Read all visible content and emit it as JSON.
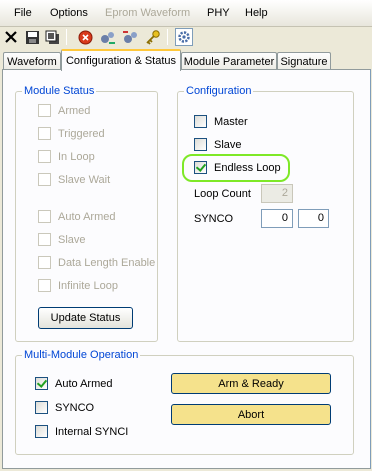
{
  "menu": {
    "file": "File",
    "options": "Options",
    "eprom_waveform": "Eprom Waveform",
    "phy": "PHY",
    "help": "Help"
  },
  "toolbar": {
    "icons": [
      "close-x-icon",
      "save-icon",
      "copy-icon",
      "stop-icon",
      "write-gears-icon",
      "read-gears-icon",
      "key-icon",
      "settings-icon"
    ]
  },
  "tabs": [
    {
      "label": "Waveform"
    },
    {
      "label": "Configuration & Status"
    },
    {
      "label": "Module Parameter"
    },
    {
      "label": "Signature"
    }
  ],
  "module_status": {
    "title": "Module Status",
    "items": [
      {
        "label": "Armed",
        "checked": false
      },
      {
        "label": "Triggered",
        "checked": false
      },
      {
        "label": "In Loop",
        "checked": false
      },
      {
        "label": "Slave Wait",
        "checked": false
      },
      {
        "label": "Auto Armed",
        "checked": false
      },
      {
        "label": "Slave",
        "checked": false
      },
      {
        "label": "Data Length Enable",
        "checked": false
      },
      {
        "label": "Infinite Loop",
        "checked": false
      }
    ],
    "update_button": "Update Status"
  },
  "configuration": {
    "title": "Configuration",
    "master": {
      "label": "Master",
      "checked": false
    },
    "slave": {
      "label": "Slave",
      "checked": false
    },
    "endless_loop": {
      "label": "Endless Loop",
      "checked": true
    },
    "loop_count_label": "Loop Count",
    "loop_count_value": "2",
    "synco_label": "SYNCO",
    "synco_value_1": "0",
    "synco_value_2": "0"
  },
  "multi_module": {
    "title": "Multi-Module Operation",
    "auto_armed": {
      "label": "Auto Armed",
      "checked": true
    },
    "synco": {
      "label": "SYNCO",
      "checked": false
    },
    "internal_synci": {
      "label": "Internal SYNCI",
      "checked": false
    },
    "arm_ready_button": "Arm & Ready",
    "abort_button": "Abort"
  },
  "colors": {
    "group_title": "#0046d5",
    "highlight": "#7ee827",
    "yellow_button": "#f5e28c"
  }
}
